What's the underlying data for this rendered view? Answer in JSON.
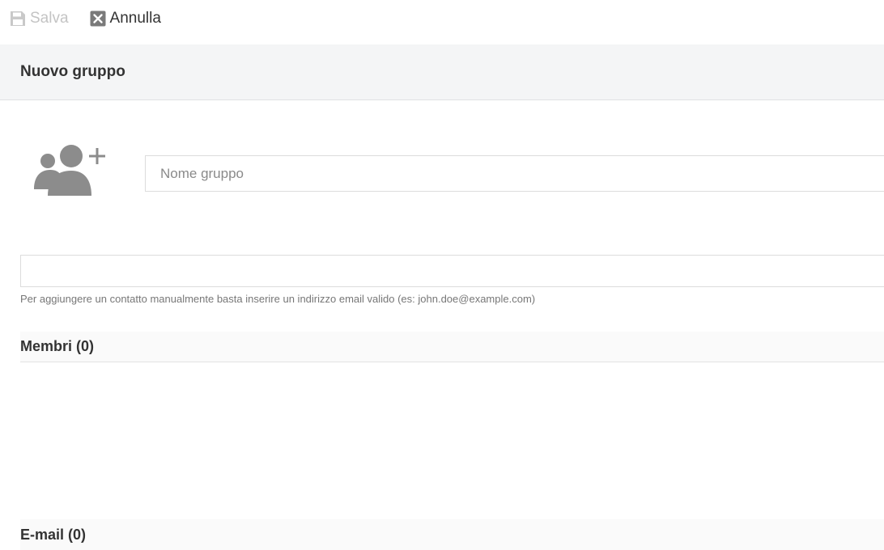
{
  "toolbar": {
    "save_label": "Salva",
    "save_icon": "floppy-disk-icon",
    "cancel_label": "Annulla",
    "cancel_icon": "close-box-icon"
  },
  "header": {
    "title": "Nuovo gruppo"
  },
  "group": {
    "avatar_icon": "add-group-icon",
    "name_placeholder": "Nome gruppo",
    "name_value": ""
  },
  "contact": {
    "value": "",
    "help": "Per aggiungere un contatto manualmente basta inserire un indirizzo email valido (es: john.doe@example.com)"
  },
  "sections": {
    "members_title": "Membri (0)",
    "emails_title": "E-mail (0)"
  },
  "colors": {
    "icon_gray": "#8c8c8c",
    "disabled_text": "#c4c4c4",
    "header_bg": "#f4f5f6"
  }
}
